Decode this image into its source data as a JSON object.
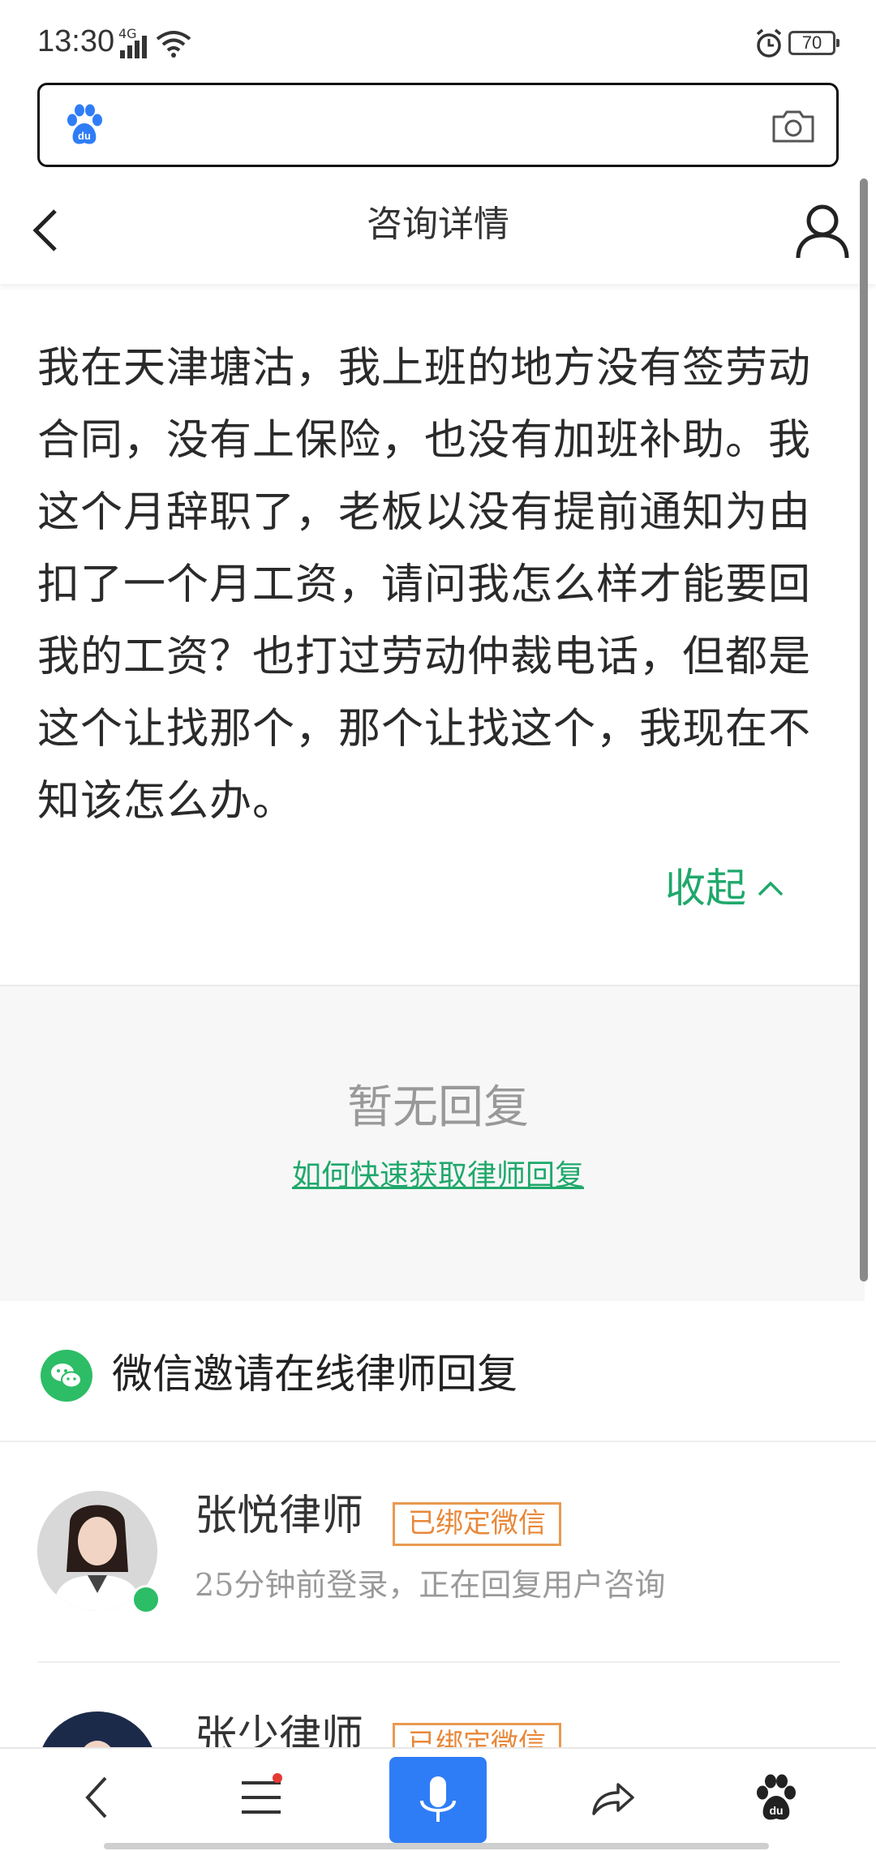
{
  "status_bar": {
    "time": "13:30",
    "network": "4G",
    "battery": "70"
  },
  "header": {
    "title": "咨询详情"
  },
  "question": {
    "text": "我在天津塘沽，我上班的地方没有签劳动合同，没有上保险，也没有加班补助。我这个月辞职了，老板以没有提前通知为由扣了一个月工资，请问我怎么样才能要回我的工资？也打过劳动仲裁电话，但都是这个让找那个，那个让找这个，我现在不知该怎么办。",
    "collapse_label": "收起"
  },
  "replies": {
    "empty_text": "暂无回复",
    "how_link": "如何快速获取律师回复"
  },
  "wechat_invite": {
    "title": "微信邀请在线律师回复"
  },
  "lawyers": [
    {
      "name": "张悦律师",
      "badge": "已绑定微信",
      "status": "25分钟前登录，正在回复用户咨询",
      "online": true
    },
    {
      "name": "张少律师",
      "badge": "已绑定微信",
      "status": "",
      "online": false
    }
  ],
  "colors": {
    "accent": "#1fa86b",
    "badge": "#e8883a",
    "mic": "#2f7df6",
    "online": "#2dbd66"
  },
  "icons": {
    "search_bar": [
      "baidu-paw-icon",
      "camera-icon"
    ],
    "header": [
      "back-icon",
      "user-icon"
    ],
    "bottom_nav": [
      "back-icon",
      "menu-icon",
      "mic-icon",
      "share-icon",
      "baidu-paw-icon"
    ]
  }
}
